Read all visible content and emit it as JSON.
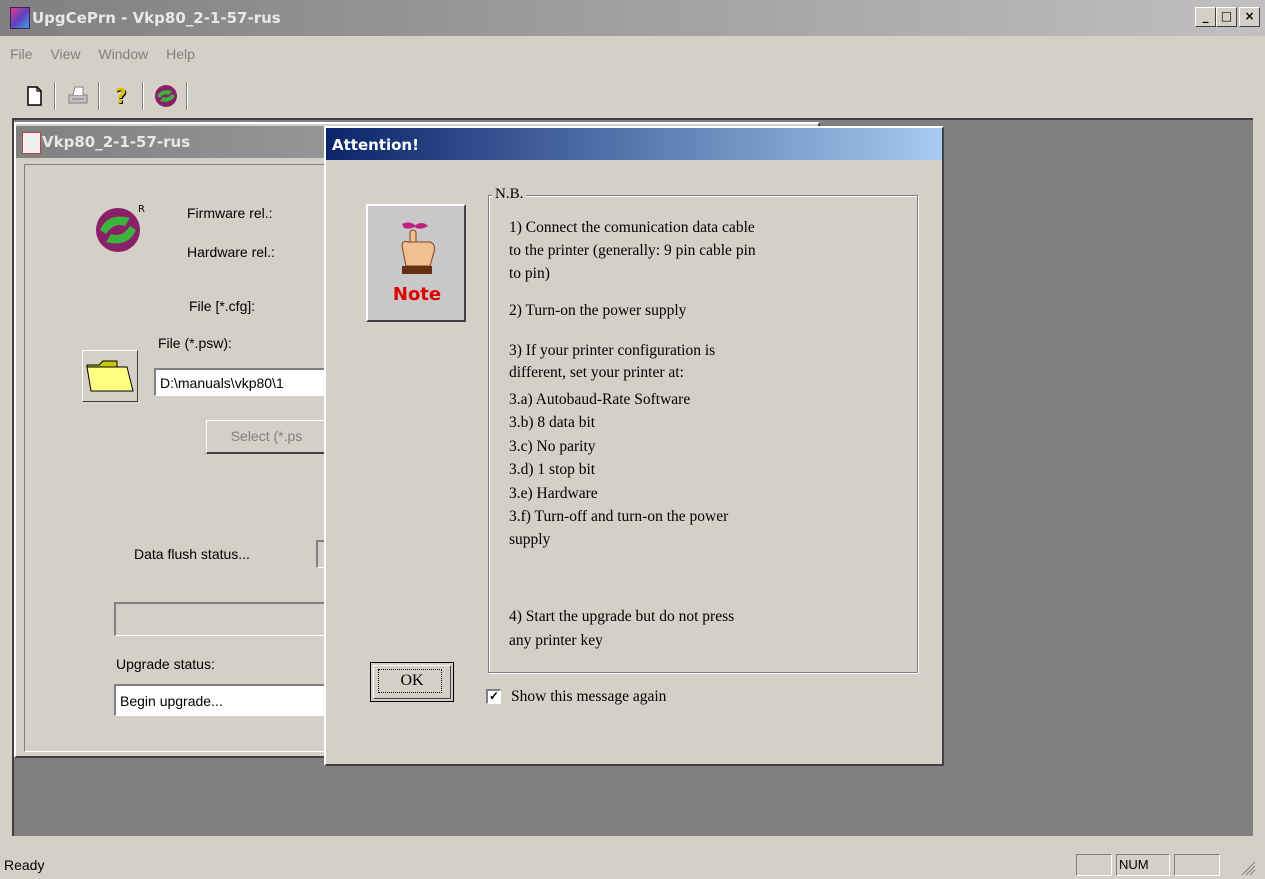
{
  "app": {
    "title": "UpgCePrn - Vkp80_2-1-57-rus",
    "window_buttons": [
      "_",
      "□",
      "×"
    ]
  },
  "menu": [
    "File",
    "View",
    "Window",
    "Help"
  ],
  "toolbar": {
    "icons": [
      "new-document-icon",
      "print-icon",
      "help-icon",
      "app-logo-icon"
    ]
  },
  "child_window": {
    "title": "Vkp80_2-1-57-rus",
    "firmware_label": "Firmware rel.:",
    "hardware_label": "Hardware rel.:",
    "cfg_label": "File [*.cfg]:",
    "psw_label": "File (*.psw):",
    "psw_path": "D:\\manuals\\vkp80\\1",
    "select_button": "Select (*.ps",
    "data_flush_label": "Data flush status...",
    "upgrade_status_label": "Upgrade status:",
    "upgrade_status_value": "Begin upgrade..."
  },
  "dialog": {
    "title": "Attention!",
    "note_label": "Note",
    "group_label": "N.B.",
    "lines": [
      "1) Connect the comunication data cable",
      "to the printer (generally: 9 pin cable pin",
      "to pin)",
      "2) Turn-on the power supply",
      "3) If your printer configuration is",
      "different, set your printer at:",
      "3.a) Autobaud-Rate Software",
      "3.b) 8 data bit",
      "3.c) No parity",
      "3.d) 1 stop bit",
      "3.e) Hardware",
      "3.f) Turn-off and turn-on the power",
      "supply",
      "4) Start the upgrade but do not press",
      "any printer key"
    ],
    "ok_button": "OK",
    "checkbox_label": "Show this message again",
    "checkbox_checked": true
  },
  "statusbar": {
    "text": "Ready",
    "num": "NUM"
  }
}
